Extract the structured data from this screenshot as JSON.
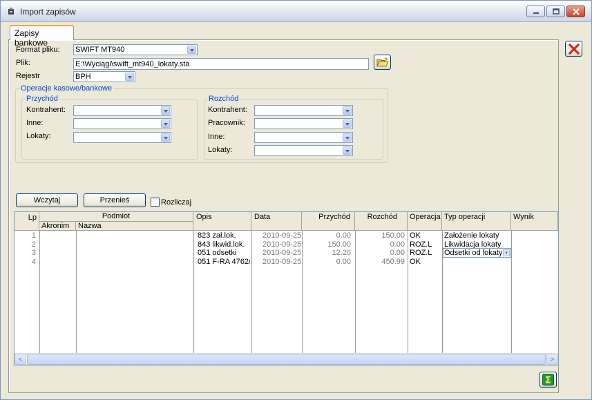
{
  "window": {
    "title": "Import zapisów",
    "controls": [
      "minimize",
      "maximize",
      "close"
    ]
  },
  "tab": {
    "label": "Zapisy bankowe"
  },
  "form": {
    "format_label": "Format pliku:",
    "format_value": "SWIFT MT940",
    "file_label": "Plik:",
    "file_value": "E:\\Wyciągi\\swift_mt940_lokaty.sta",
    "register_label": "Rejestr",
    "register_value": "BPH"
  },
  "operations": {
    "title": "Operacje kasowe/bankowe",
    "income": {
      "title": "Przychód",
      "contractor_label": "Kontrahent:",
      "other_label": "Inne:",
      "deposits_label": "Lokaty:"
    },
    "expense": {
      "title": "Rozchód",
      "contractor_label": "Kontrahent:",
      "employee_label": "Pracownik:",
      "other_label": "Inne:",
      "deposits_label": "Lokaty:"
    }
  },
  "actions": {
    "load": "Wczytaj",
    "transfer": "Przenieś",
    "settle_label": "Rozliczaj",
    "settle_checked": false
  },
  "table": {
    "headers": {
      "lp": "Lp",
      "podmiot": "Podmiot",
      "akronim": "Akronim",
      "nazwa": "Nazwa",
      "opis": "Opis",
      "data": "Data",
      "przychod": "Przychód",
      "rozchod": "Rozchód",
      "operacja": "Operacja",
      "typ": "Typ operacji",
      "wynik": "Wynik"
    },
    "rows": [
      {
        "lp": "1",
        "akronim": "",
        "nazwa": "",
        "opis": "823  zał.lok.",
        "data": "2010-09-25",
        "przychod": "0.00",
        "rozchod": "150.00",
        "operacja": "OK",
        "typ": "Założenie lokaty",
        "wynik": ""
      },
      {
        "lp": "2",
        "akronim": "",
        "nazwa": "",
        "opis": "843  likwid.lok.",
        "data": "2010-09-25",
        "przychod": "150.00",
        "rozchod": "0.00",
        "operacja": "ROZ.L",
        "typ": "Likwidacja lokaty",
        "wynik": ""
      },
      {
        "lp": "3",
        "akronim": "",
        "nazwa": "",
        "opis": "051  odsetki",
        "data": "2010-09-25",
        "przychod": "12.20",
        "rozchod": "0.00",
        "operacja": "ROZ.L",
        "typ": "Odsetki od lokaty",
        "wynik": ""
      },
      {
        "lp": "4",
        "akronim": "",
        "nazwa": "",
        "opis": "051  F-RA 4762/",
        "data": "2010-09-25",
        "przychod": "0.00",
        "rozchod": "450.99",
        "operacja": "OK",
        "typ": "",
        "wynik": ""
      }
    ]
  },
  "icons": {
    "open_file": "folder-open-icon",
    "close_form": "red-x-icon",
    "sum": "sigma-icon"
  },
  "colors": {
    "close_red": "#d42a1a",
    "sigma_green": "#1f9a3a",
    "group_title_blue": "#0046d5",
    "tab_accent": "#f5a540"
  }
}
